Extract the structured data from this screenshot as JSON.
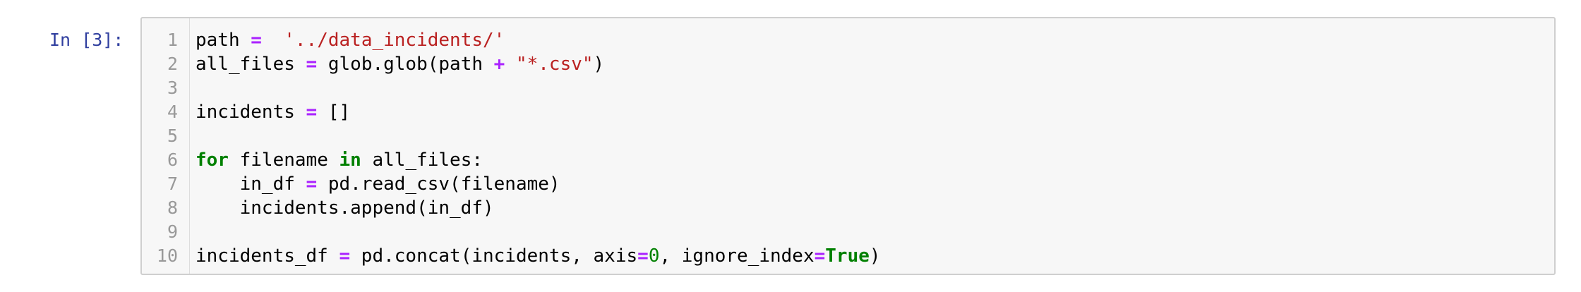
{
  "cell": {
    "prompt": "In [3]:",
    "lines": [
      {
        "num": "1",
        "tokens": [
          {
            "t": "path ",
            "c": "plain"
          },
          {
            "t": "=",
            "c": "op"
          },
          {
            "t": "  ",
            "c": "plain"
          },
          {
            "t": "'../data_incidents/'",
            "c": "str"
          }
        ]
      },
      {
        "num": "2",
        "tokens": [
          {
            "t": "all_files ",
            "c": "plain"
          },
          {
            "t": "=",
            "c": "op"
          },
          {
            "t": " glob.glob(path ",
            "c": "plain"
          },
          {
            "t": "+",
            "c": "op"
          },
          {
            "t": " ",
            "c": "plain"
          },
          {
            "t": "\"*.csv\"",
            "c": "str"
          },
          {
            "t": ")",
            "c": "plain"
          }
        ]
      },
      {
        "num": "3",
        "tokens": []
      },
      {
        "num": "4",
        "tokens": [
          {
            "t": "incidents ",
            "c": "plain"
          },
          {
            "t": "=",
            "c": "op"
          },
          {
            "t": " []",
            "c": "plain"
          }
        ]
      },
      {
        "num": "5",
        "tokens": []
      },
      {
        "num": "6",
        "tokens": [
          {
            "t": "for",
            "c": "kw"
          },
          {
            "t": " filename ",
            "c": "plain"
          },
          {
            "t": "in",
            "c": "kw"
          },
          {
            "t": " all_files:",
            "c": "plain"
          }
        ]
      },
      {
        "num": "7",
        "tokens": [
          {
            "t": "    in_df ",
            "c": "plain"
          },
          {
            "t": "=",
            "c": "op"
          },
          {
            "t": " pd.read_csv(filename)",
            "c": "plain"
          }
        ]
      },
      {
        "num": "8",
        "tokens": [
          {
            "t": "    incidents.append(in_df)",
            "c": "plain"
          }
        ]
      },
      {
        "num": "9",
        "tokens": []
      },
      {
        "num": "10",
        "tokens": [
          {
            "t": "incidents_df ",
            "c": "plain"
          },
          {
            "t": "=",
            "c": "op"
          },
          {
            "t": " pd.concat(incidents, axis",
            "c": "plain"
          },
          {
            "t": "=",
            "c": "op"
          },
          {
            "t": "0",
            "c": "num"
          },
          {
            "t": ", ignore_index",
            "c": "plain"
          },
          {
            "t": "=",
            "c": "op"
          },
          {
            "t": "True",
            "c": "bi"
          },
          {
            "t": ")",
            "c": "plain"
          }
        ]
      }
    ]
  }
}
